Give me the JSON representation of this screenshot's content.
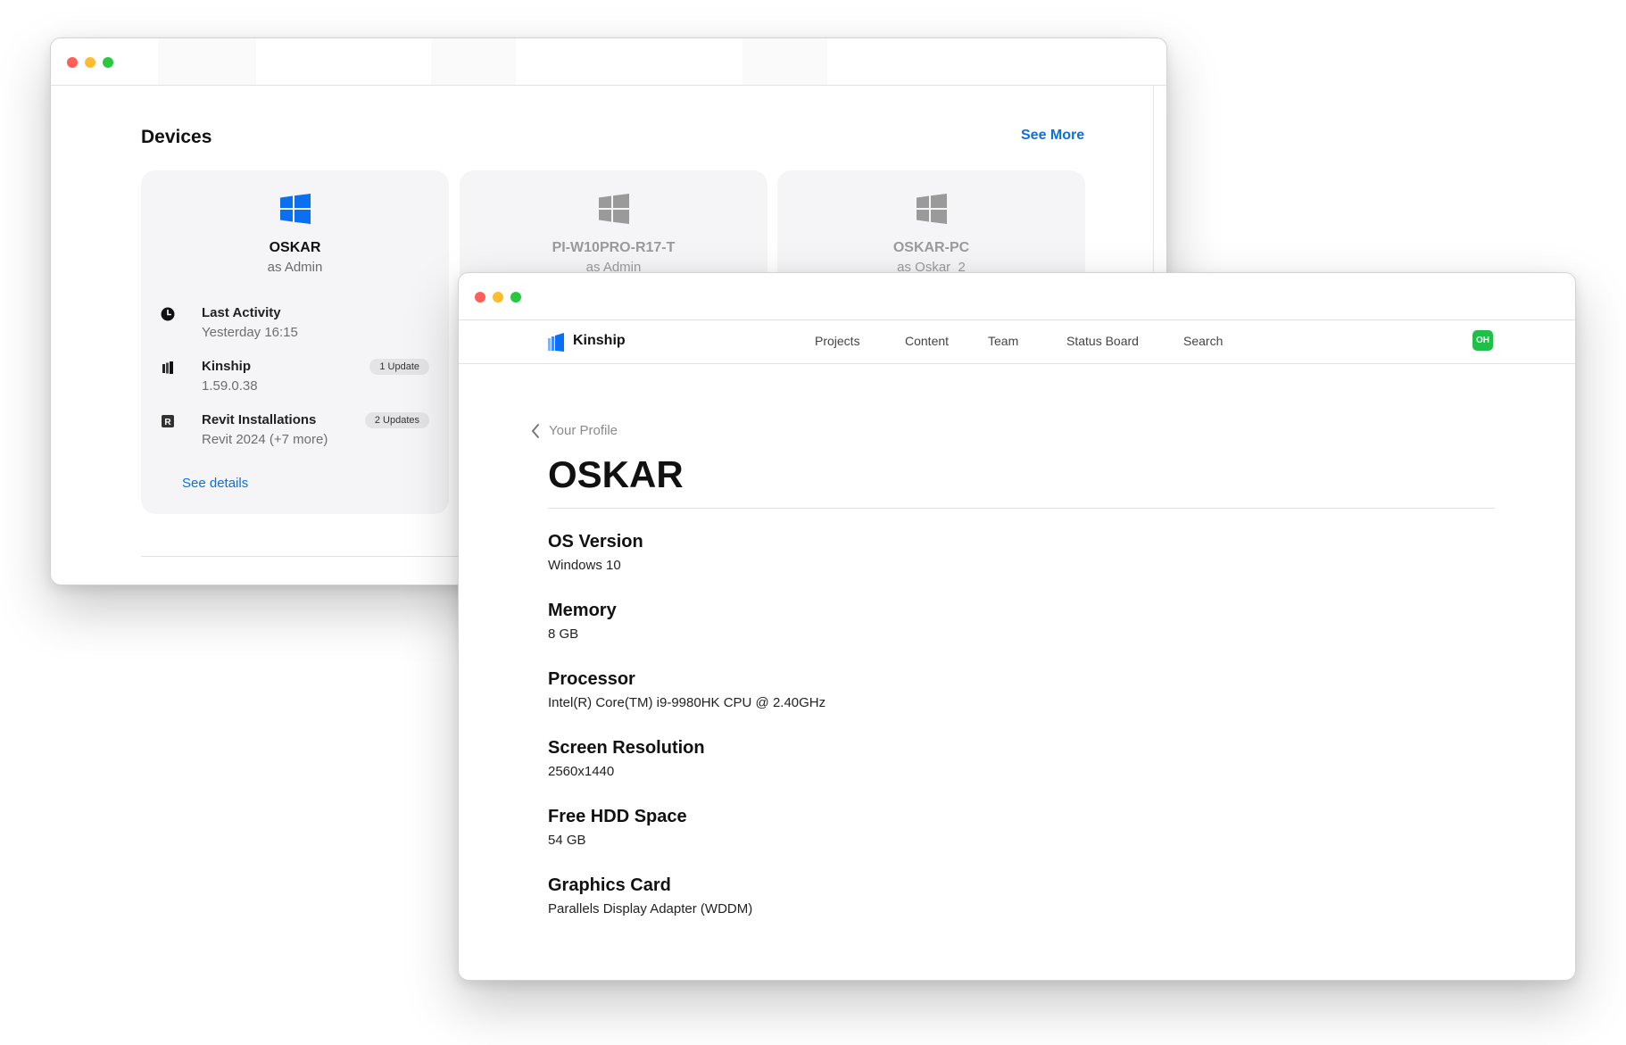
{
  "devices_window": {
    "section_title": "Devices",
    "see_more_label": "See More",
    "cards": [
      {
        "name": "OSKAR",
        "role": "as Admin",
        "os_icon": "windows-logo-icon",
        "details": [
          {
            "label": "Last Activity",
            "value": "Yesterday 16:15",
            "icon": "clock-icon",
            "badge": ""
          },
          {
            "label": "Kinship",
            "value": "1.59.0.38",
            "icon": "kinship-app-icon",
            "badge": "1 Update"
          },
          {
            "label": "Revit Installations",
            "value": "Revit 2024 (+7 more)",
            "icon": "revit-icon",
            "badge": "2 Updates"
          }
        ],
        "see_details_label": "See details"
      },
      {
        "name": "PI-W10PRO-R17-T",
        "role": "as Admin",
        "os_icon": "windows-logo-icon"
      },
      {
        "name": "OSKAR-PC",
        "role": "as Oskar_2",
        "os_icon": "windows-logo-icon"
      }
    ],
    "colors": {
      "accent": "#0a72e0",
      "windows_blue": "#0a6ff0",
      "windows_gray": "#9a9a9a"
    }
  },
  "profile_window": {
    "nav": {
      "brand": "Kinship",
      "items": [
        "Projects",
        "Content",
        "Team",
        "Status Board",
        "Search"
      ],
      "avatar_initials": "OH",
      "avatar_color": "#1fbf4a"
    },
    "breadcrumb_back": "Your Profile",
    "device_title": "OSKAR",
    "specs": [
      {
        "label": "OS Version",
        "value": "Windows 10"
      },
      {
        "label": "Memory",
        "value": "8 GB"
      },
      {
        "label": "Processor",
        "value": "Intel(R) Core(TM) i9-9980HK CPU @ 2.40GHz"
      },
      {
        "label": "Screen Resolution",
        "value": "2560x1440"
      },
      {
        "label": "Free HDD Space",
        "value": "54 GB"
      },
      {
        "label": "Graphics Card",
        "value": "Parallels Display Adapter (WDDM)"
      }
    ]
  }
}
